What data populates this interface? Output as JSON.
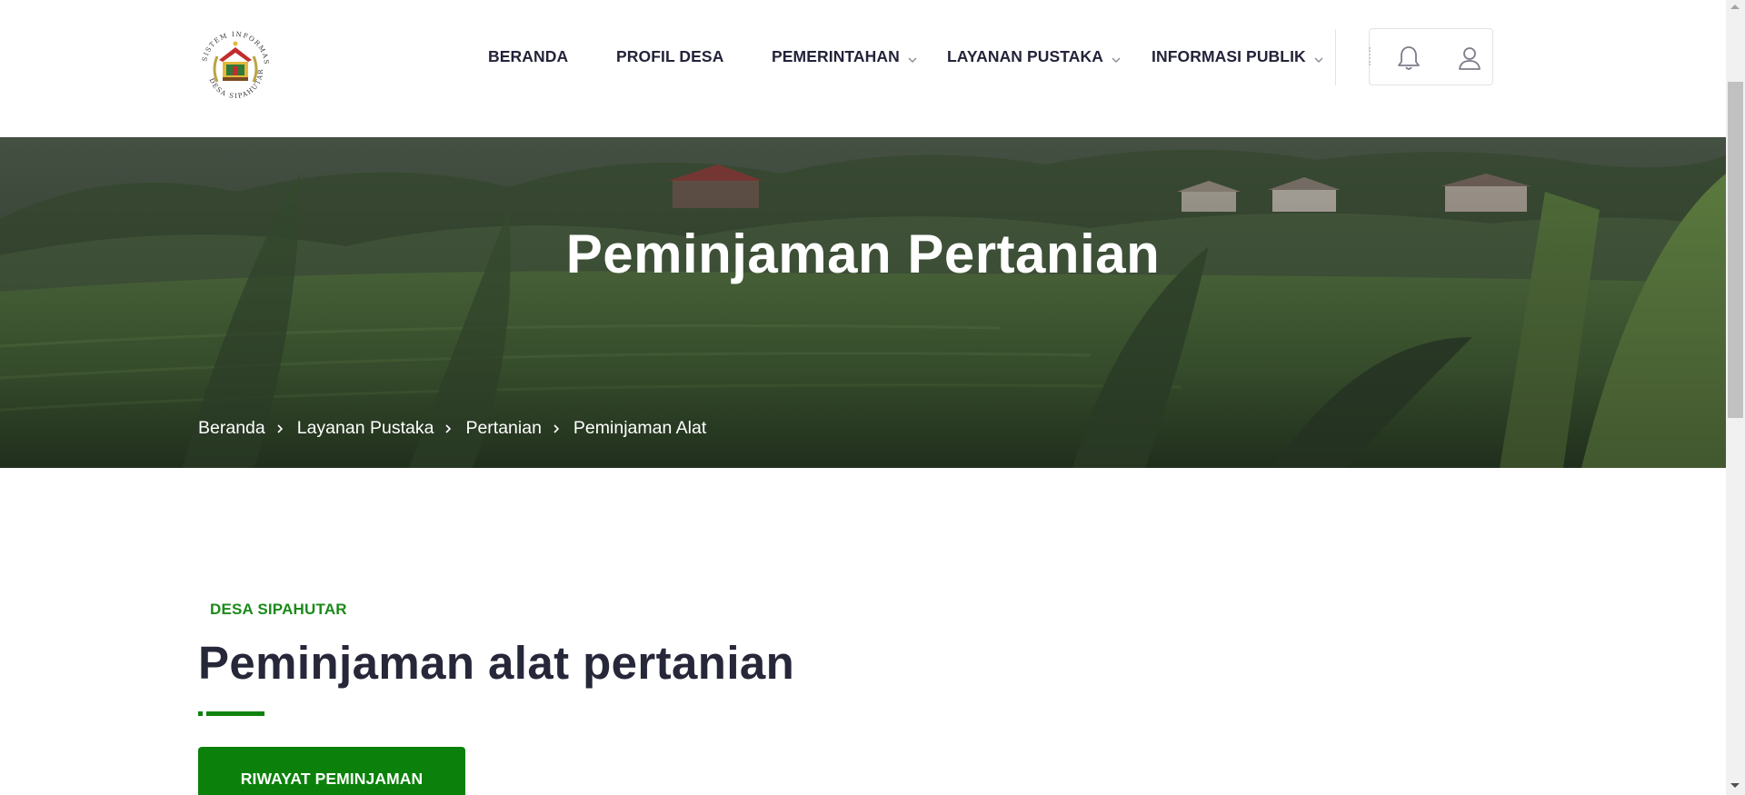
{
  "header": {
    "logo": {
      "icon": "village-crest-logo",
      "ring_text_top": "SISTEM INFORMASI",
      "ring_text_bottom": "DESA SIPAHUTAR"
    },
    "nav": [
      {
        "label": "BERANDA",
        "has_dropdown": false
      },
      {
        "label": "PROFIL DESA",
        "has_dropdown": false
      },
      {
        "label": "PEMERINTAHAN",
        "has_dropdown": true
      },
      {
        "label": "LAYANAN PUSTAKA",
        "has_dropdown": true
      },
      {
        "label": "INFORMASI PUBLIK",
        "has_dropdown": true
      }
    ],
    "icons": [
      "bell-icon",
      "user-icon"
    ]
  },
  "hero": {
    "title": "Peminjaman Pertanian",
    "breadcrumb": [
      "Beranda",
      "Layanan Pustaka",
      "Pertanian",
      "Peminjaman Alat"
    ]
  },
  "content": {
    "eyebrow": "DESA SIPAHUTAR",
    "title": "Peminjaman alat pertanian",
    "cta_label": "RIWAYAT PEMINJAMAN"
  },
  "colors": {
    "accent_green": "#0b810b",
    "eyebrow_green": "#1a8a1a",
    "heading": "#27273a",
    "nav_text": "#23233a"
  }
}
